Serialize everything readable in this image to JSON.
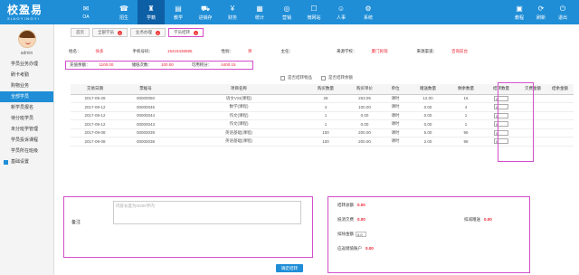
{
  "brand": {
    "name": "校盈易",
    "sub": "XIAOYINGYI"
  },
  "topnav": [
    {
      "label": "OA",
      "icon": "message-icon",
      "glyph": "✉"
    },
    {
      "label": "招生",
      "icon": "megaphone-icon",
      "glyph": "☎"
    },
    {
      "label": "学籍",
      "icon": "graduation-icon",
      "glyph": "♜"
    },
    {
      "label": "教学",
      "icon": "book-icon",
      "glyph": "▤"
    },
    {
      "label": "进销存",
      "icon": "cart-icon",
      "glyph": "⛟"
    },
    {
      "label": "财务",
      "icon": "finance-icon",
      "glyph": "¥"
    },
    {
      "label": "统计",
      "icon": "chart-icon",
      "glyph": "▦"
    },
    {
      "label": "营销",
      "icon": "target-icon",
      "glyph": "◎"
    },
    {
      "label": "微网站",
      "icon": "web-icon",
      "glyph": "☐"
    },
    {
      "label": "人事",
      "icon": "person-icon",
      "glyph": "☺"
    },
    {
      "label": "系统",
      "icon": "gear-icon",
      "glyph": "⚙"
    }
  ],
  "rightnav": [
    {
      "label": "教程",
      "icon": "tutorial-icon",
      "glyph": "▣"
    },
    {
      "label": "刷新",
      "icon": "refresh-icon",
      "glyph": "⟳"
    },
    {
      "label": "退出",
      "icon": "logout-icon",
      "glyph": "⏻"
    }
  ],
  "active_nav": "学籍",
  "sidebar": {
    "username": "admin",
    "items": [
      "学员业务办理",
      "刷卡考勤",
      "购物业务",
      "全部学员",
      "新学员报名",
      "待分班学员",
      "未分班学管理",
      "学员投诉课程",
      "学员所在班级"
    ],
    "active_item": "全部学员",
    "group": "基础设置"
  },
  "tabs": [
    {
      "label": "首页",
      "closable": false
    },
    {
      "label": "全部学员",
      "closable": true
    },
    {
      "label": "业务办理",
      "closable": true
    },
    {
      "label": "学员结转",
      "closable": true
    }
  ],
  "student": {
    "name_label": "姓名：",
    "name": "徐多",
    "phone_label": "手机号码：",
    "phone": "15415436595",
    "gender_label": "性别：",
    "gender": "男",
    "owner_label": "主任：",
    "owner": "",
    "school_label": "来源学校：",
    "school": "厦门民瑞",
    "channel_label": "来源渠道：",
    "channel": "咨询前台"
  },
  "balance": {
    "prepaid_label": "充值余额：",
    "prepaid": "1100.00",
    "savings_label": "储值次数：",
    "savings": "100.00",
    "points_label": "可用积分：",
    "points": "4400.15"
  },
  "checks": [
    "是否结转物品",
    "是否结转余额"
  ],
  "table": {
    "headers": [
      "交易日期",
      "票据号",
      "项目名称",
      "购买数量",
      "购买单价",
      "单位",
      "赠送数量",
      "剩余数量",
      "结转数量",
      "欠费金额",
      "结余金额"
    ],
    "rows": [
      [
        "2017-09-28",
        "00000050",
        "语文VSI(课程)",
        "28",
        "253.05",
        "课时",
        "12.00",
        "16",
        "0",
        "",
        ""
      ],
      [
        "2017-09-12",
        "00000045",
        "数学(课程)",
        "4",
        "100.00",
        "课时",
        "0.00",
        "4",
        "0",
        "",
        ""
      ],
      [
        "2017-09-12",
        "00000044",
        "作文(课程)",
        "1",
        "0.00",
        "课时",
        "0.00",
        "1",
        "0",
        "",
        ""
      ],
      [
        "2017-09-12",
        "00000043",
        "作文(课程)",
        "1",
        "0.00",
        "课时",
        "0.00",
        "1",
        "0",
        "",
        ""
      ],
      [
        "2017-09-08",
        "00000039",
        "英语基础(课程)",
        "100",
        "200.00",
        "课时",
        "5.00",
        "95",
        "0",
        "",
        ""
      ],
      [
        "2017-09-08",
        "00000038",
        "英语基础(课程)",
        "100",
        "200.00",
        "课时",
        "2.00",
        "98",
        "0",
        "",
        ""
      ]
    ]
  },
  "remark": {
    "label": "备注",
    "placeholder": "内容长度为0/200字内"
  },
  "summary": {
    "transfer_label": "结转总额",
    "transfer": "0.00",
    "arrears_label": "抵消欠费",
    "arrears": "0.00",
    "deduct_label": "扣减赠送",
    "deduct": "0.00",
    "fee_label": "扣除金额",
    "fee": "0.0",
    "account_label": "应返储值账户",
    "account": "0.00"
  },
  "confirm_label": "确定结转",
  "colors": {
    "primary": "#1f8ed7",
    "highlight": "#d24ecb",
    "red": "#e23"
  }
}
